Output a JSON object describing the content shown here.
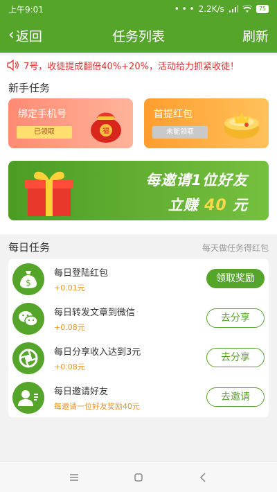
{
  "status_bar": {
    "time": "上午9:01",
    "net_speed": "2.2K/s",
    "battery": "75"
  },
  "nav": {
    "back_label": "返回",
    "title": "任务列表",
    "refresh_label": "刷新"
  },
  "notice": {
    "text": "7号，收徒提成翻倍40%+20%，活动给力抓紧收徒！"
  },
  "newbie": {
    "title": "新手任务",
    "cards": [
      {
        "title": "绑定手机号",
        "badge": "已领取"
      },
      {
        "title": "首提红包",
        "badge": "未能领取"
      }
    ]
  },
  "invite_banner": {
    "line1": "每邀请1位好友",
    "line2_prefix": "立赚",
    "amount": "40",
    "unit": "元"
  },
  "daily": {
    "title": "每日任务",
    "subtitle": "每天做任务得红包",
    "tasks": [
      {
        "name": "每日登陆红包",
        "reward": "+0.01元",
        "button": "领取奖励",
        "icon": "money-bag-icon"
      },
      {
        "name": "每日转发文章到微信",
        "reward": "+0.08元",
        "button": "去分享",
        "icon": "wechat-icon"
      },
      {
        "name": "每日分享收入达到3元",
        "reward": "+0.08元",
        "button": "去分享",
        "icon": "shutter-icon"
      },
      {
        "name": "每日邀请好友",
        "reward": "每邀请一位好友奖励40元",
        "button": "去邀请",
        "icon": "invite-user-icon"
      }
    ]
  },
  "colors": {
    "primary": "#55a52a",
    "notice_red": "#e0312f",
    "reward_orange": "#e89426"
  }
}
